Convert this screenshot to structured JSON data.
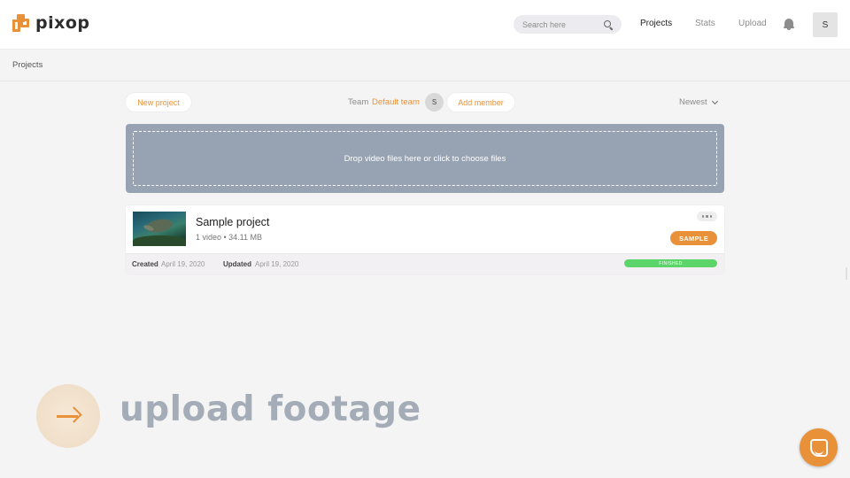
{
  "app": {
    "name": "pixop",
    "brand_color": "#e89139"
  },
  "header": {
    "search": {
      "placeholder": "Search here"
    },
    "nav": [
      {
        "label": "Projects",
        "active": true
      },
      {
        "label": "Stats",
        "active": false
      },
      {
        "label": "Upload",
        "active": false
      }
    ],
    "user_initial": "S"
  },
  "breadcrumb": {
    "label": "Projects"
  },
  "controls": {
    "new_project_label": "New project",
    "team_label": "Team",
    "team_name": "Default team",
    "team_member_initial": "S",
    "add_member_label": "Add member",
    "sort_label": "Newest"
  },
  "dropzone": {
    "text": "Drop video files here or click to choose files",
    "background": "#97a3b3"
  },
  "projects": [
    {
      "title": "Sample project",
      "meta": "1 video • 34.11 MB",
      "badge": "SAMPLE",
      "created_label": "Created",
      "created_date": "April 19, 2020",
      "updated_label": "Updated",
      "updated_date": "April 19, 2020",
      "status": "FINISHED",
      "status_color": "#5bd46a"
    }
  ],
  "overlay": {
    "caption": "upload footage"
  }
}
